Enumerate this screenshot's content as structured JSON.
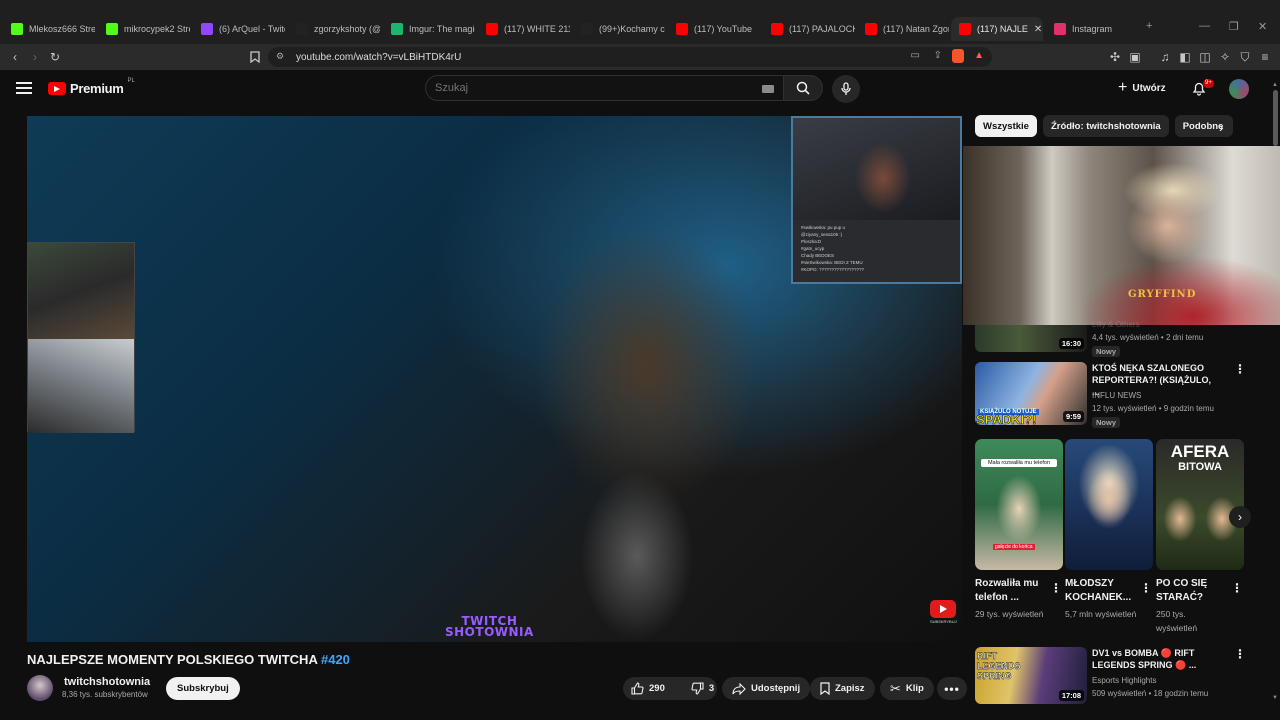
{
  "browser": {
    "tabs": [
      {
        "title": "Mlekosz666 Strea",
        "icon": "kick-icon",
        "color": "#53fc18"
      },
      {
        "title": "mikrocypek2 Stre",
        "icon": "kick-icon",
        "color": "#53fc18"
      },
      {
        "title": "(6) ArQuel - Twitc",
        "icon": "twitch-icon",
        "color": "#9146ff"
      },
      {
        "title": "zgorzykshoty (@",
        "icon": "tiktok-icon",
        "color": "#222222"
      },
      {
        "title": "Imgur: The magic",
        "icon": "imgur-icon",
        "color": "#1bb76e"
      },
      {
        "title": "(117) WHITE 211!",
        "icon": "youtube-icon",
        "color": "#ff0000"
      },
      {
        "title": "(99+)Kochamy ci",
        "icon": "tiktok-icon",
        "color": "#222222"
      },
      {
        "title": "(117) YouTube",
        "icon": "youtube-icon",
        "color": "#ff0000"
      },
      {
        "title": "(117) PAJALOCK",
        "icon": "youtube-icon",
        "color": "#ff0000"
      },
      {
        "title": "(117) Natan Zgor",
        "icon": "youtube-icon",
        "color": "#ff0000"
      },
      {
        "title": "(117) NAJLE",
        "icon": "youtube-icon",
        "color": "#ff0000",
        "active": true
      },
      {
        "title": "Instagram",
        "icon": "instagram-icon",
        "color": "#e1306c"
      }
    ],
    "url": "youtube.com/watch?v=vLBiHTDK4rU"
  },
  "header": {
    "logo_text": "Premium",
    "country": "PL",
    "search_placeholder": "Szukaj",
    "create_label": "Utwórz",
    "notification_count": "9+"
  },
  "player": {
    "watermark_line1": "TWITCH",
    "watermark_line2": "SHOTOWNIA",
    "sub_badge": "SUBSKRYBUJ",
    "chat_lines": [
      "#swikowska: pu pup u",
      "@ziyany_sena105 :)",
      "Ploszka:D",
      "#gatn_ucyp",
      "Chady BEDOES",
      "#nieSwikowska: BEDI Z TEMU",
      "#KOPO: ??????????????????"
    ]
  },
  "video": {
    "title": "NAJLEPSZE MOMENTY POLSKIEGO TWITCHA",
    "hashtag": "#420",
    "channel_name": "twitchshotownia",
    "channel_subs": "8,36 tys. subskrybentów",
    "subscribe_label": "Subskrybuj",
    "likes": "290",
    "dislikes": "3",
    "share_label": "Udostępnij",
    "save_label": "Zapisz",
    "clip_label": "Klip"
  },
  "sidebar": {
    "chips": [
      "Wszystkie",
      "Źródło: twitchshotownia",
      "Podobne"
    ],
    "overlay_text": "GRYFFIND",
    "recommendations": [
      {
        "title": "",
        "channel": "Lilly & Others",
        "meta": "4,4 tys. wyświetleń • 2 dni temu",
        "duration": "16:30",
        "badge": "Nowy"
      },
      {
        "title": "KTOŚ NĘKA SZALONEGO REPORTERA?! (KSIĄŻULO, ...",
        "channel": "INFLU NEWS",
        "meta": "12 tys. wyświetleń • 9 godzin temu",
        "duration": "9:59",
        "badge": "Nowy",
        "thumb_text": "SPADKI?!",
        "thumb_text2": "KSIĄŻULO NOTUJE"
      },
      {
        "title": "DV1 vs BOMBA 🔴 RIFT LEGENDS SPRING 🔴 ...",
        "channel": "Esports Highlights",
        "meta": "509 wyświetleń • 18 godzin temu",
        "duration": "17:08",
        "thumb_text": "RIFT LEGENDS SPRING"
      }
    ],
    "shorts": [
      {
        "title": "Rozwaliła mu telefon ...",
        "views": "29 tys. wyświetleń",
        "overlay": "Mała rozwaliła mu telefon",
        "caption": "gałęzie do końca"
      },
      {
        "title": "MŁODSZY KOCHANEK...",
        "views": "5,7 mln wyświetleń"
      },
      {
        "title": "PO CO SIĘ STARAĆ?",
        "views": "250 tys. wyświetleń",
        "overlay": "AFERA",
        "overlay2": "BITOWA"
      }
    ]
  }
}
